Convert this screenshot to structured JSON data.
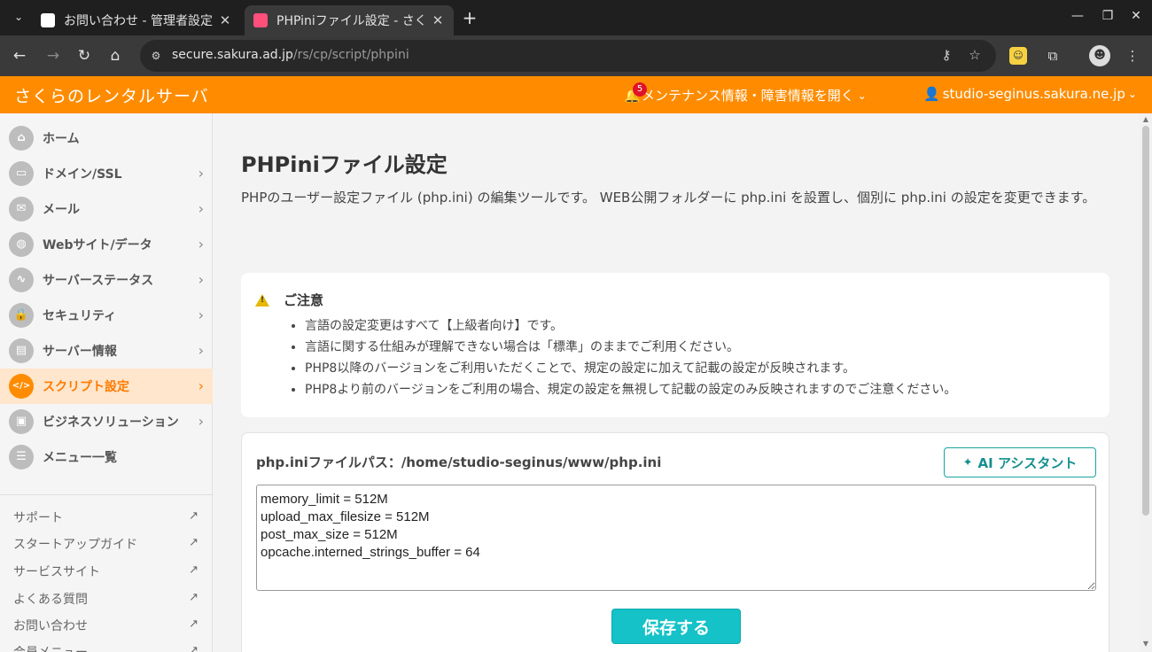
{
  "browser": {
    "tabs": [
      {
        "title": "お問い合わせ - 管理者設定",
        "active": false
      },
      {
        "title": "PHPiniファイル設定 - さくら",
        "active": true
      }
    ],
    "url_host": "secure.sakura.ad.jp",
    "url_path": "/rs/cp/script/phpini"
  },
  "header": {
    "brand": "さくらのレンタルサーバ",
    "notif_count": "5",
    "maintenance_label": "メンテナンス情報・障害情報を開く",
    "account": "studio-seginus.sakura.ne.jp"
  },
  "sidebar": {
    "items": [
      {
        "label": "ホーム",
        "icon": "⌂"
      },
      {
        "label": "ドメイン/SSL",
        "icon": "▭"
      },
      {
        "label": "メール",
        "icon": "✉"
      },
      {
        "label": "Webサイト/データ",
        "icon": "◍"
      },
      {
        "label": "サーバーステータス",
        "icon": "∿"
      },
      {
        "label": "セキュリティ",
        "icon": "🔒"
      },
      {
        "label": "サーバー情報",
        "icon": "▤"
      },
      {
        "label": "スクリプト設定",
        "icon": "</>"
      },
      {
        "label": "ビジネスソリューション",
        "icon": "▣"
      },
      {
        "label": "メニュー一覧",
        "icon": "☰"
      }
    ],
    "links": [
      "サポート",
      "スタートアップガイド",
      "サービスサイト",
      "よくある質問",
      "お問い合わせ",
      "会員メニュー"
    ]
  },
  "main": {
    "title": "PHPiniファイル設定",
    "description": "PHPのユーザー設定ファイル (php.ini) の編集ツールです。 WEB公開フォルダーに php.ini を設置し、個別に php.ini の設定を変更できます。",
    "notice": {
      "heading": "ご注意",
      "items": [
        "言語の設定変更はすべて【上級者向け】です。",
        "言語に関する仕組みが理解できない場合は「標準」のままでご利用ください。",
        "PHP8以降のバージョンをご利用いただくことで、規定の設定に加えて記載の設定が反映されます。",
        "PHP8より前のバージョンをご利用の場合、規定の設定を無視して記載の設定のみ反映されますのでご注意ください。"
      ]
    },
    "editor": {
      "path_label": "php.iniファイルパス：/home/studio-seginus/www/php.ini",
      "ai_button": "AI アシスタント",
      "content": "memory_limit = 512M\nupload_max_filesize = 512M\npost_max_size = 512M\nopcache.interned_strings_buffer = 64",
      "save_button": "保存する"
    }
  },
  "colors": {
    "brand": "#ff8c00",
    "save": "#14c2c8",
    "ai": "#1aa3a3"
  }
}
